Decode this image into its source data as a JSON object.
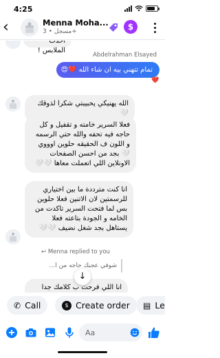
{
  "status_bar": {
    "time": "4:25"
  },
  "header": {
    "name": "Menna Moha...",
    "subtitle": "مسجل • 3+",
    "colors": {
      "accent": "#a033ff",
      "tag": "#8a5cf6"
    }
  },
  "thread": {
    "top_partial_text": "أخذت الملابس !",
    "sender_label": "Abdelrahman Elsayed",
    "outgoing_message": "تمام تتهني بيه ان شاء الله ❤️😍",
    "outgoing_reaction": "❤️",
    "incoming_messages": [
      {
        "text": "الله يهنيكي يحبيبتي شكرا لذوقك 🤍"
      },
      {
        "text": "فعلا السرير خامته و تقفيل و كل حاجه فيه تحفه والله حتي الرسمه و اللون ف الحقيقه حلوين اوووي 🤍 بجد من احسن الصفحات الاونلاين اللي اتعملت معاها 🤍🤍"
      },
      {
        "text": "انا كنت مترددة ما بين اختياري للرسمتين لان الاتنين فعلا حلوين بس لما فتحت السرير تاكدت من الخامه و الجودة بتاعته فعلا يستاهل بجد شغل نضيف 🤍🤍"
      }
    ],
    "reply_note": "Menna replied to you",
    "quoted_text": "شوفي عجبك حاجه من ا...",
    "bottom_partial_text": "انا اللي فرحت ب كلامك جدا"
  },
  "quick_actions": [
    {
      "label": "Call",
      "icon": "phone-icon"
    },
    {
      "label": "Create order",
      "icon": "dollar-icon"
    },
    {
      "label": "Lea",
      "icon": "document-icon"
    }
  ],
  "composer": {
    "placeholder": "Aa",
    "icons": [
      "plus-icon",
      "camera-icon",
      "gallery-icon",
      "microphone-icon",
      "emoji-icon",
      "like-icon"
    ],
    "accent": "#0a7cff"
  }
}
